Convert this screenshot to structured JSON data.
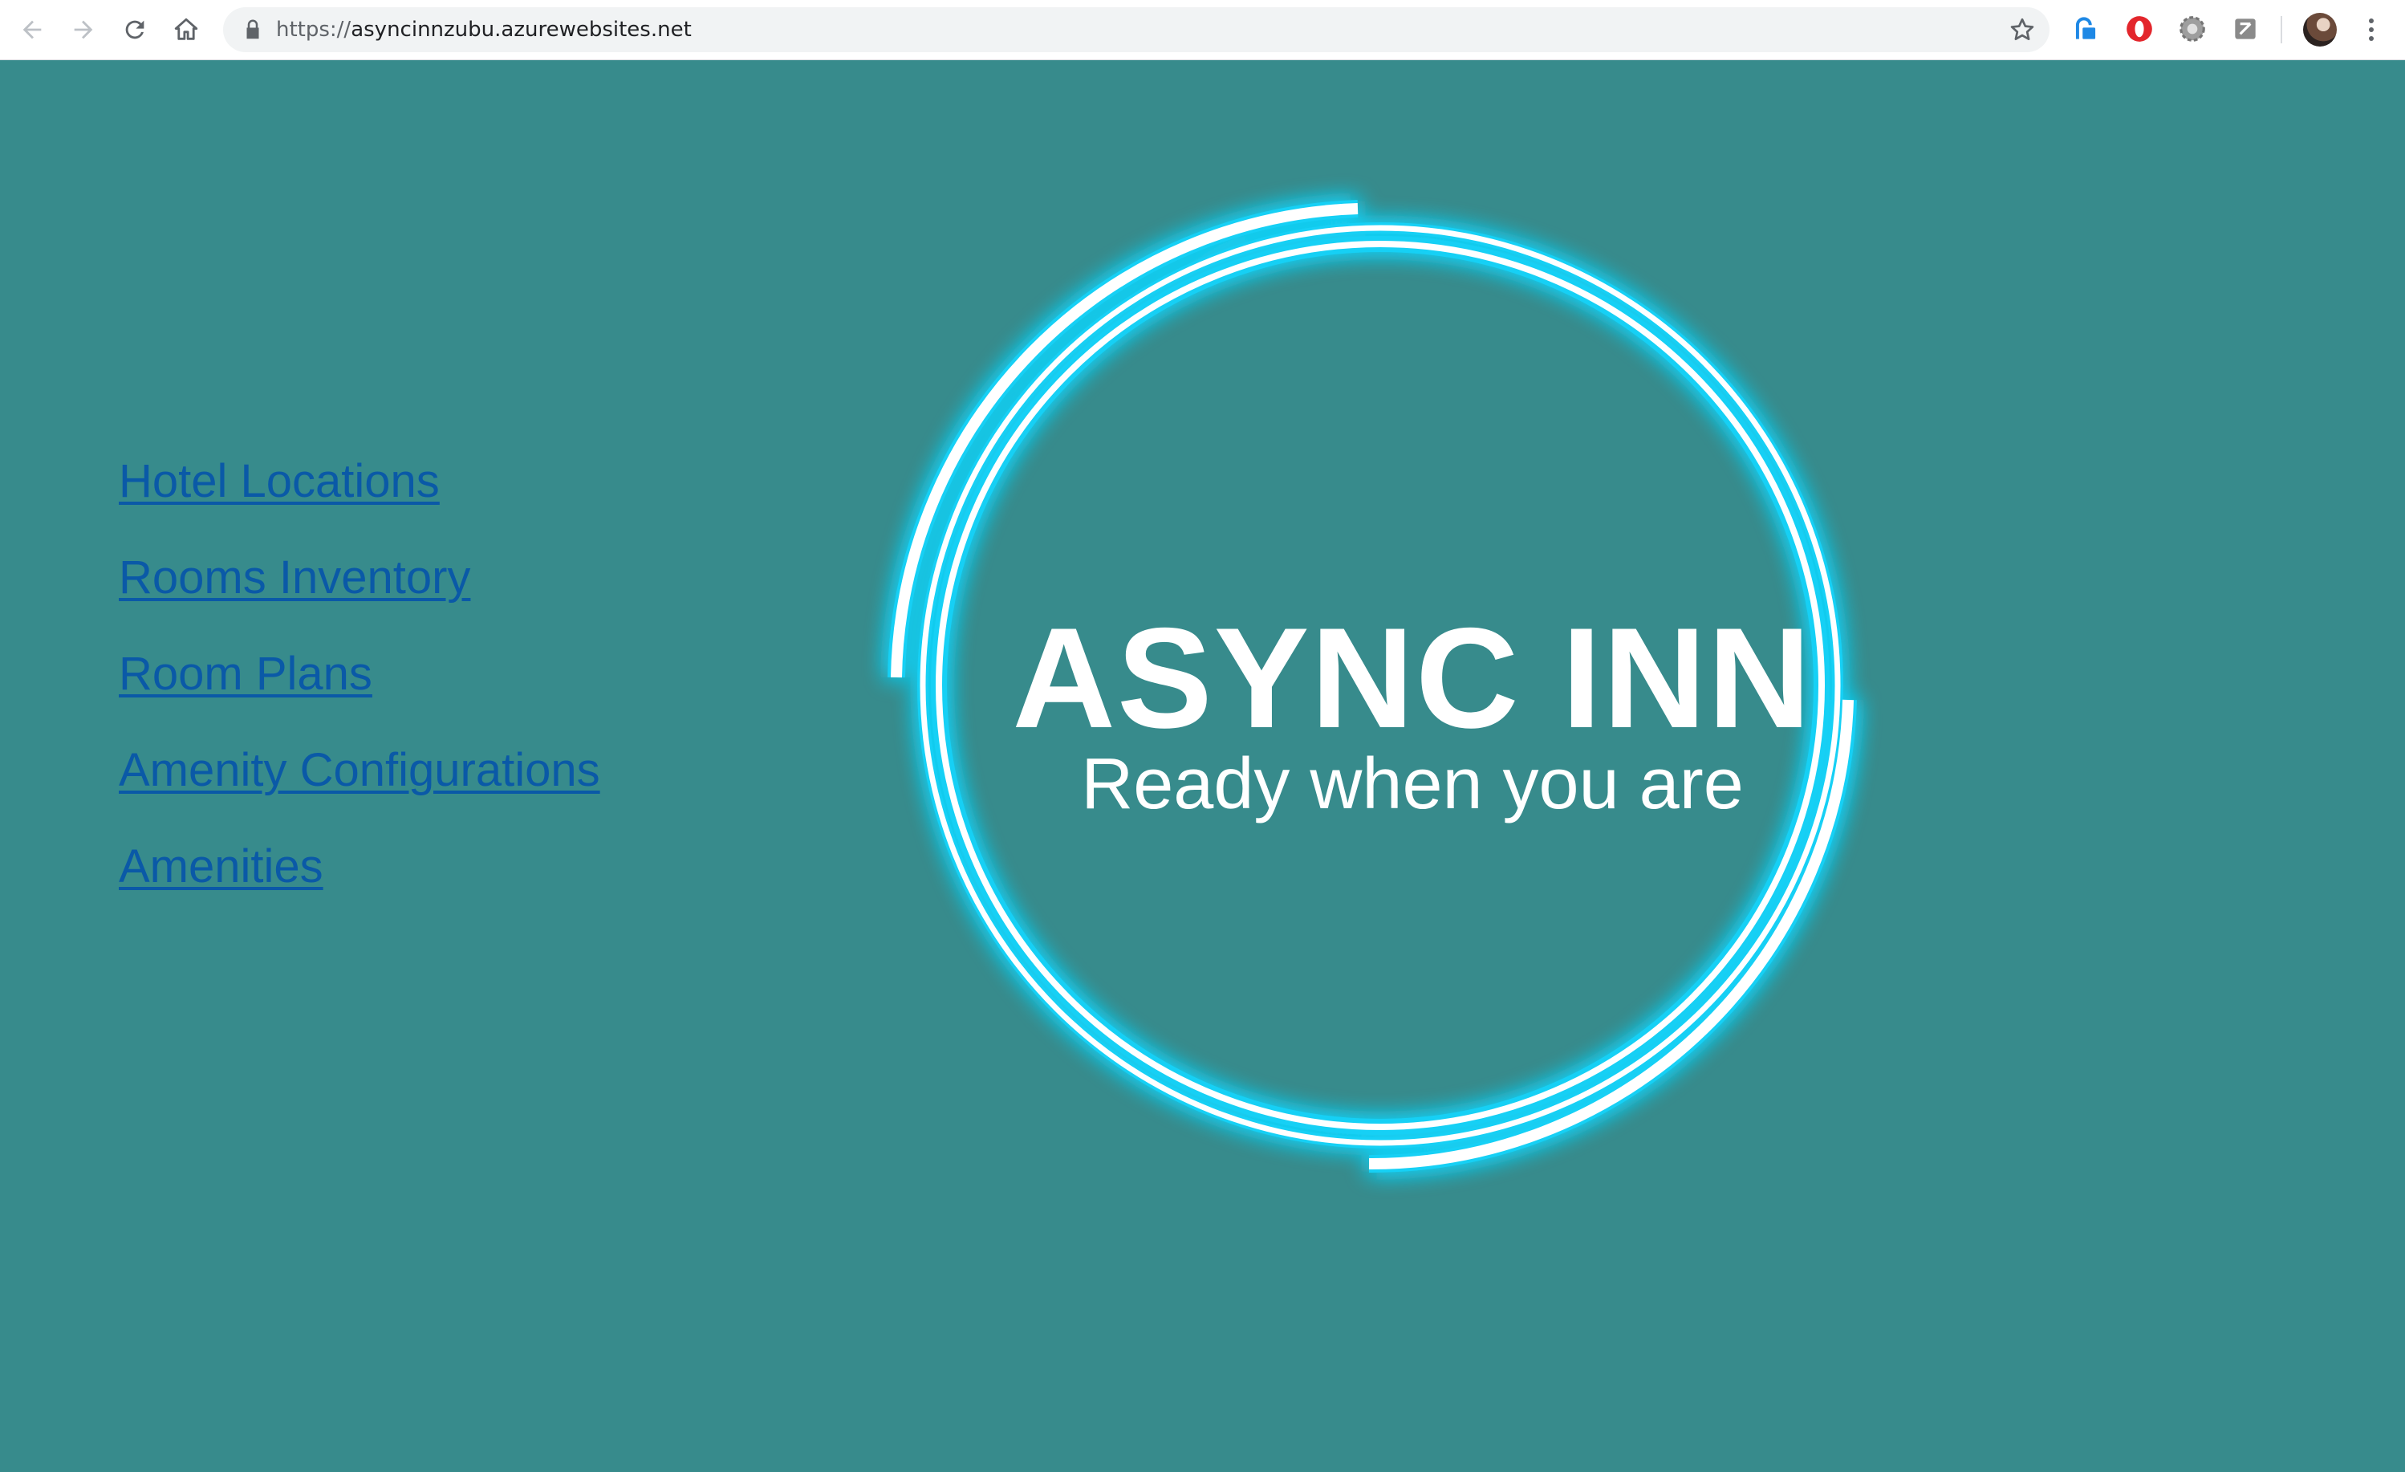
{
  "browser": {
    "url_scheme": "https://",
    "url_host": "asyncinnzubu.azurewebsites.net",
    "back_icon": "arrow-left-icon",
    "forward_icon": "arrow-right-icon",
    "reload_icon": "reload-icon",
    "home_icon": "home-icon",
    "bookmark_icon": "star-icon",
    "extensions": [
      "lastpass-icon",
      "opera-icon",
      "gear-extension-icon",
      "zotero-icon"
    ]
  },
  "nav": {
    "links": [
      "Hotel Locations",
      "Rooms Inventory",
      "Room Plans",
      "Amenity Configurations",
      "Amenities"
    ]
  },
  "brand": {
    "title": "ASYNC INN",
    "tagline": "Ready when you are"
  },
  "colors": {
    "page_background": "#378b8c",
    "link": "#0a59a7",
    "ring_glow": "#18d0f5",
    "text": "#ffffff"
  }
}
